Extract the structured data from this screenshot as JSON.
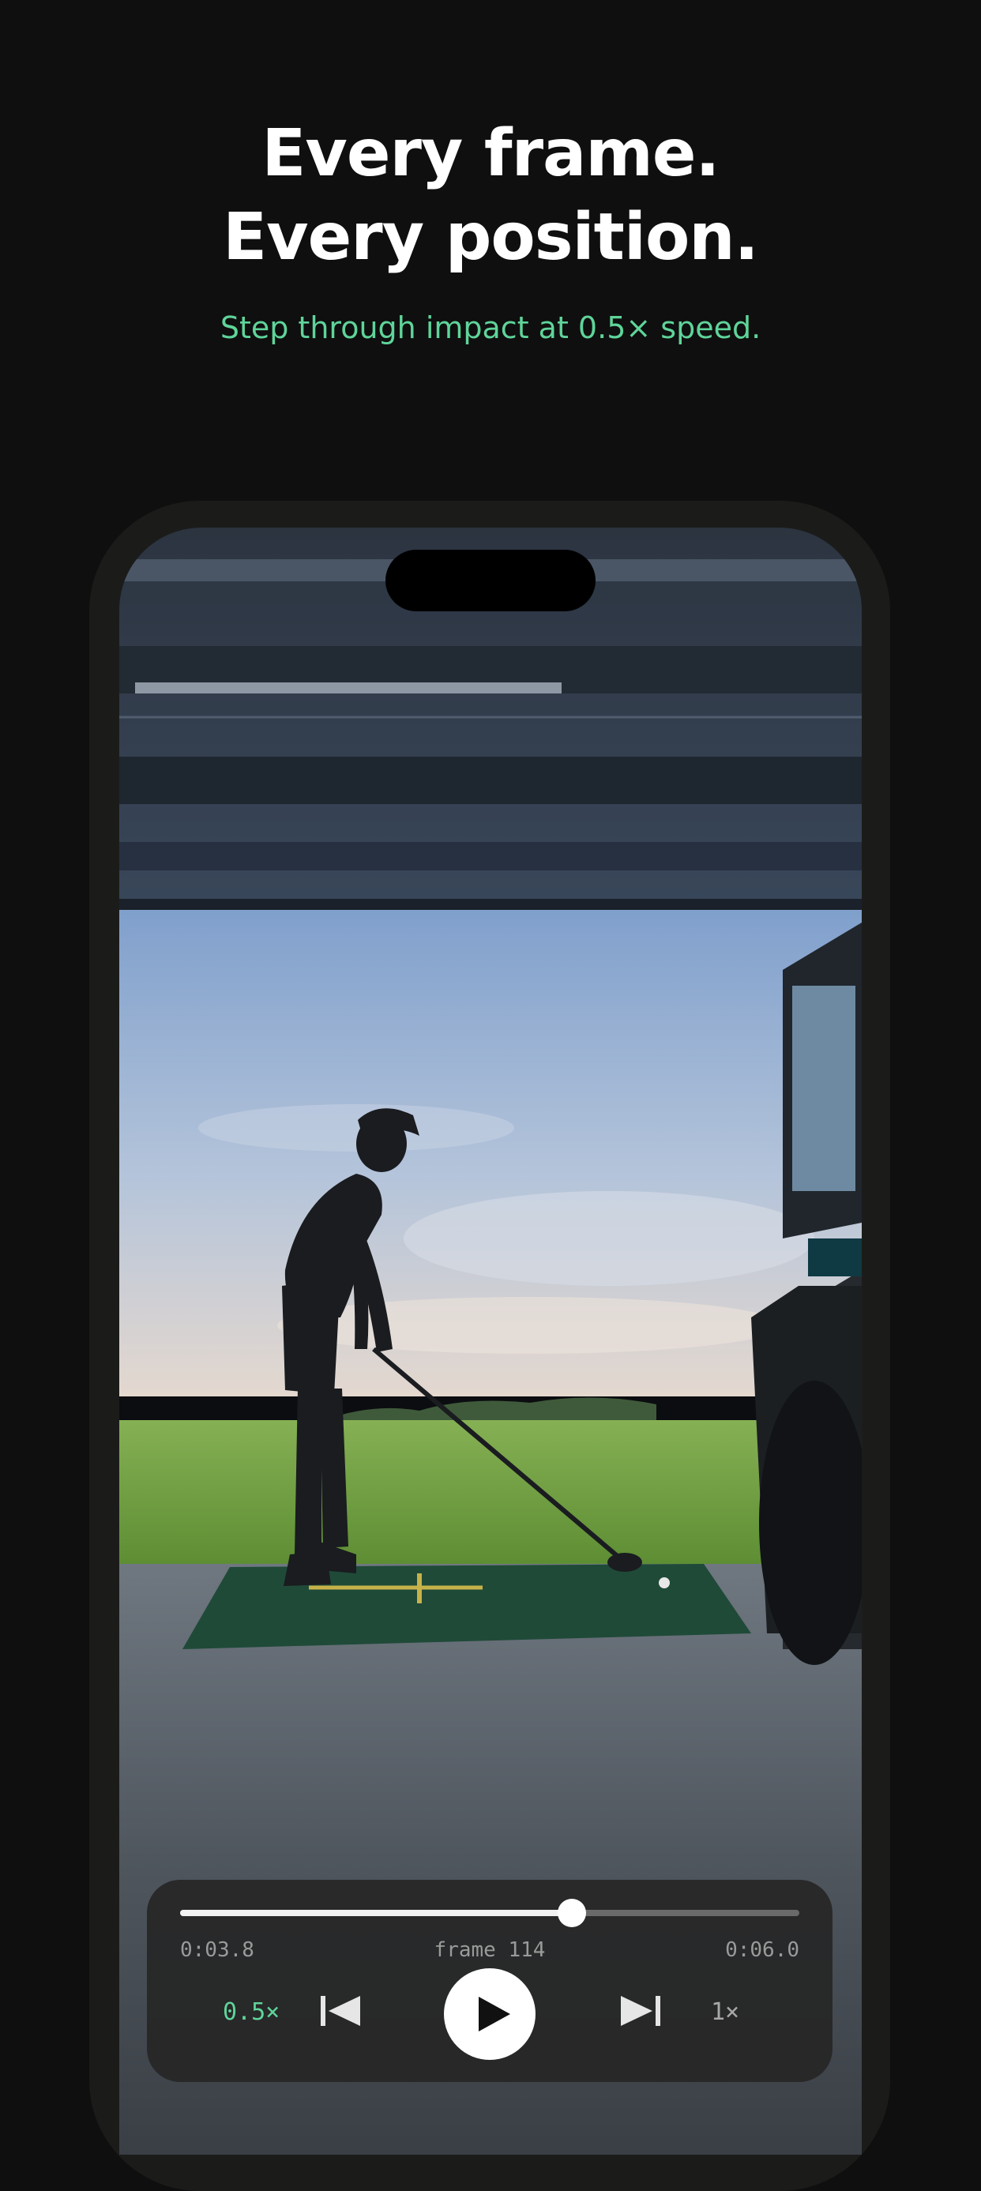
{
  "headline": {
    "line1": "Every frame.",
    "line2": "Every position."
  },
  "subheadline": "Step through impact at 0.5× speed.",
  "player": {
    "current_time": "0:03.8",
    "frame_label": "frame 114",
    "total_time": "0:06.0",
    "progress": 0.633,
    "slow_speed_label": "0.5×",
    "normal_speed_label": "1×"
  },
  "colors": {
    "background": "#0f0f0f",
    "accent": "#5fd49a",
    "phone_frame": "#1b1c1a"
  },
  "icons": [
    "skip-back-icon",
    "play-icon",
    "skip-forward-icon"
  ]
}
